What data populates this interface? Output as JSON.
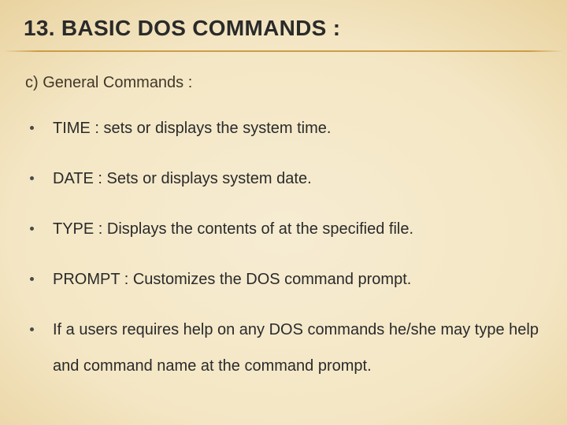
{
  "title": "13. BASIC DOS COMMANDS :",
  "subhead": "c) General Commands :",
  "bullets": [
    "TIME : sets or displays the system time.",
    "DATE : Sets or displays system date.",
    "TYPE : Displays the contents of at the specified file.",
    "PROMPT : Customizes the DOS command prompt.",
    "If a users requires help on any DOS commands he/she may type help and command name at the command prompt."
  ]
}
